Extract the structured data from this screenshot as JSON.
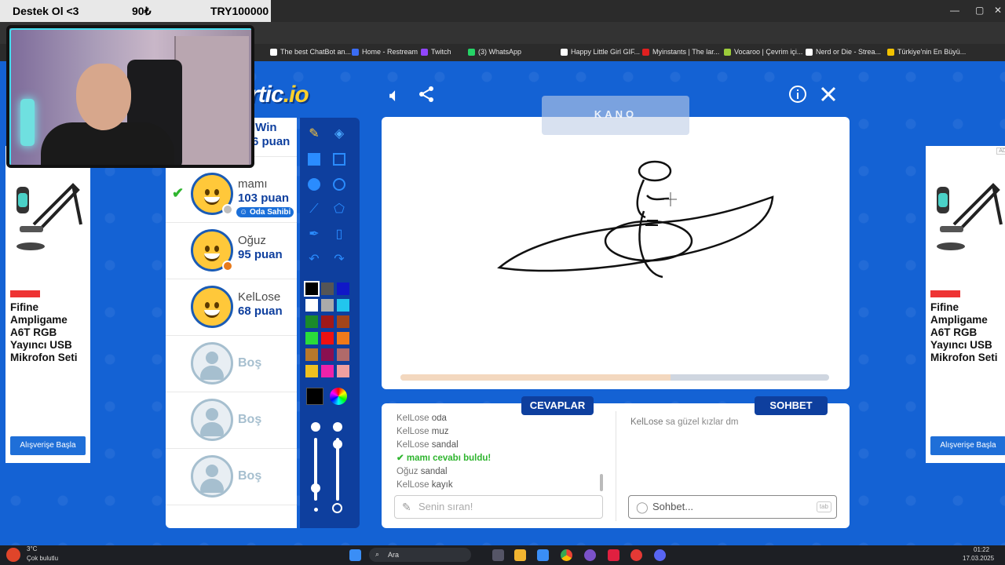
{
  "overlay": {
    "donate_label": "Destek Ol <3",
    "donate_min": "90₺",
    "donate_goal": "TRY100000"
  },
  "bookmarks": [
    {
      "label": "The best ChatBot an...",
      "color": "#ffffff"
    },
    {
      "label": "Home - Restream",
      "color": "#3a6cf4"
    },
    {
      "label": "Twitch",
      "color": "#9146ff"
    },
    {
      "label": "(3) WhatsApp",
      "color": "#25d366"
    },
    {
      "label": "Happy Little Girl GIF...",
      "color": "#ffffff"
    },
    {
      "label": "Myinstants | The lar...",
      "color": "#e02020"
    },
    {
      "label": "Vocaroo | Çevrim içi...",
      "color": "#9ccc3a"
    },
    {
      "label": "Nerd or Die - Strea...",
      "color": "#ffffff"
    },
    {
      "label": "Türkiye'nin En Büyü...",
      "color": "#f2c200"
    }
  ],
  "game": {
    "logo_text": "rtic",
    "logo_suffix": ".io",
    "word_hint": "KANO",
    "progress": 0.63
  },
  "players": [
    {
      "name": "lWin",
      "points": "6 puan",
      "partial": true
    },
    {
      "name": "mamı",
      "points": "103 puan",
      "guessed": true,
      "badge": "Oda Sahibi",
      "dot": "#bdbdbd"
    },
    {
      "name": "Oğuz",
      "points": "95 puan",
      "dot": "#e87a1a"
    },
    {
      "name": "KelLose",
      "points": "68 puan"
    },
    {
      "name": "Boş",
      "empty": true
    },
    {
      "name": "Boş",
      "empty": true
    },
    {
      "name": "Boş",
      "empty": true
    }
  ],
  "palette": [
    "#000000",
    "#555555",
    "#1018c8",
    "#ffffff",
    "#aaaaaa",
    "#22c6ee",
    "#1a8a2a",
    "#a01818",
    "#a3451a",
    "#2adc3a",
    "#ee1111",
    "#f07a1a",
    "#b8782a",
    "#8a1050",
    "#b06a6a",
    "#f0c020",
    "#ee22aa",
    "#f0a0a0"
  ],
  "tabs": {
    "answers": "CEVAPLAR",
    "chat": "SOHBET"
  },
  "answers": [
    {
      "who": "KelLose",
      "text": "oda"
    },
    {
      "who": "KelLose",
      "text": "muz"
    },
    {
      "who": "KelLose",
      "text": "sandal"
    },
    {
      "who": "mamı",
      "text": "cevabı buldu!",
      "correct": true
    },
    {
      "who": "Oğuz",
      "text": "sandal"
    },
    {
      "who": "KelLose",
      "text": "kayık"
    }
  ],
  "chat": [
    {
      "who": "KelLose",
      "text": "sa güzel kızlar dm"
    }
  ],
  "inputs": {
    "answer_placeholder": "Senin sıran!",
    "chat_placeholder": "Sohbet...",
    "tab_key": "tab"
  },
  "ads": {
    "title": "Fifine Ampligame A6T RGB Yayıncı USB Mikrofon Seti",
    "cta": "Alışverişe Başla",
    "tag": "AD"
  },
  "taskbar": {
    "temp": "3°C",
    "weather": "Çok bulutlu",
    "search": "Ara",
    "time": "01:22",
    "date": "17.03.2025"
  }
}
